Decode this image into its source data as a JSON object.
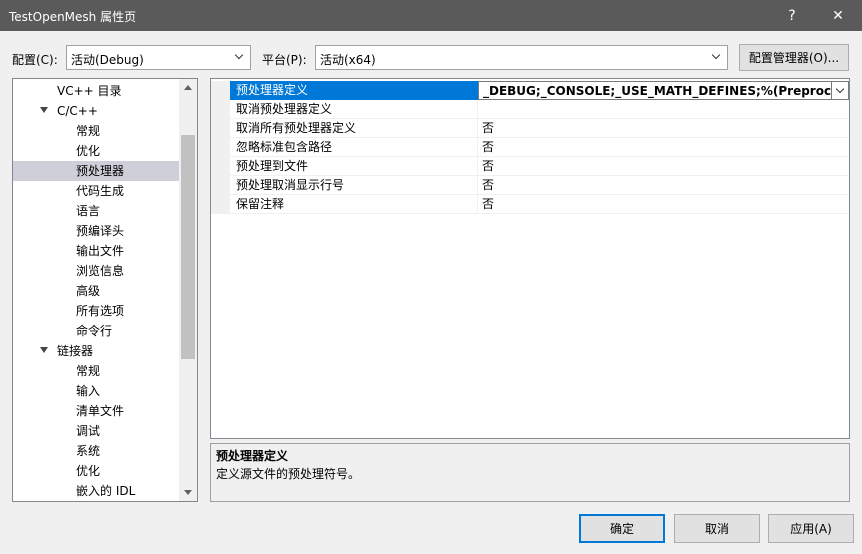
{
  "window": {
    "title": "TestOpenMesh 属性页",
    "help_label": "?",
    "close_label": "✕"
  },
  "toolbar": {
    "config_label": "配置(C):",
    "config_value": "活动(Debug)",
    "platform_label": "平台(P):",
    "platform_value": "活动(x64)",
    "config_manager_label": "配置管理器(O)..."
  },
  "tree": {
    "items": [
      {
        "label": "VC++ 目录"
      },
      {
        "label": "C/C++"
      },
      {
        "label": "常规"
      },
      {
        "label": "优化"
      },
      {
        "label": "预处理器"
      },
      {
        "label": "代码生成"
      },
      {
        "label": "语言"
      },
      {
        "label": "预编译头"
      },
      {
        "label": "输出文件"
      },
      {
        "label": "浏览信息"
      },
      {
        "label": "高级"
      },
      {
        "label": "所有选项"
      },
      {
        "label": "命令行"
      },
      {
        "label": "链接器"
      },
      {
        "label": "常规"
      },
      {
        "label": "输入"
      },
      {
        "label": "清单文件"
      },
      {
        "label": "调试"
      },
      {
        "label": "系统"
      },
      {
        "label": "优化"
      },
      {
        "label": "嵌入的 IDL"
      }
    ],
    "selected_label": "预处理器"
  },
  "properties": {
    "rows": [
      {
        "name": "预处理器定义",
        "value": "_DEBUG;_CONSOLE;_USE_MATH_DEFINES;%(PreprocessorD"
      },
      {
        "name": "取消预处理器定义",
        "value": ""
      },
      {
        "name": "取消所有预处理器定义",
        "value": "否"
      },
      {
        "name": "忽略标准包含路径",
        "value": "否"
      },
      {
        "name": "预处理到文件",
        "value": "否"
      },
      {
        "name": "预处理取消显示行号",
        "value": "否"
      },
      {
        "name": "保留注释",
        "value": "否"
      }
    ]
  },
  "description": {
    "title": "预处理器定义",
    "text": "定义源文件的预处理符号。"
  },
  "buttons": {
    "ok": "确定",
    "cancel": "取消",
    "apply": "应用(A)"
  },
  "colors": {
    "titlebar": "#5a5a5a",
    "selection_accent": "#0078d7",
    "tree_selection": "#cfcfd9"
  }
}
